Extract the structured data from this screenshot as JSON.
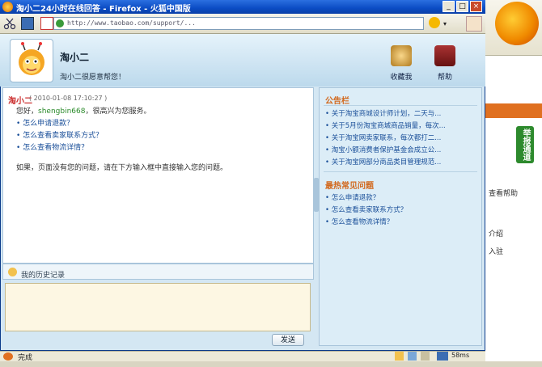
{
  "window": {
    "title": "淘小二24小时在线回答 - Firefox - 火狐中国版",
    "url": "http://www.taobao.com/support/...",
    "status": "完成",
    "status_right": "58ms"
  },
  "header": {
    "name": "淘小二",
    "subtitle": "淘小二很愿意帮您！",
    "fav_label": "收藏我",
    "help_label": "帮助"
  },
  "chat": {
    "sender": "淘小二",
    "time": "( 2010-01-08 17:10:27 )",
    "greeting_prefix": "您好，",
    "username": "shengbin668",
    "greeting_suffix": "，很高兴为您服务。",
    "links": [
      "怎么申请退款？",
      "怎么查看卖家联系方式？",
      "怎么查看物流详情？"
    ],
    "tail": "如果，页面没有您的问题，请在下方输入框中直接输入您的问题。",
    "history_label": "我的历史记录",
    "send_label": "发送"
  },
  "right": {
    "notice_title": "公告栏",
    "notices": [
      "关于淘宝商城设计师计划，二天与...",
      "关于5月份淘宝商城商品销量，每次...",
      "关于淘宝网卖家联系，每次都打二...",
      "淘宝小额消费者保护基金会成立公...",
      "关于淘宝网部分商品类目管理规范..."
    ],
    "faq_title": "最热常见问题",
    "faqs": [
      "怎么申请退款？",
      "怎么查看卖家联系方式？",
      "怎么查看物流详情？"
    ]
  },
  "background_page": {
    "green_tab": "举报通道",
    "text1": "查看帮助",
    "text2": "介绍",
    "text3": "入驻"
  },
  "colors": {
    "titlebar": "#0b4cc4",
    "panel": "#dcedf7",
    "accent": "#d2691e",
    "link": "#1a4f99"
  }
}
